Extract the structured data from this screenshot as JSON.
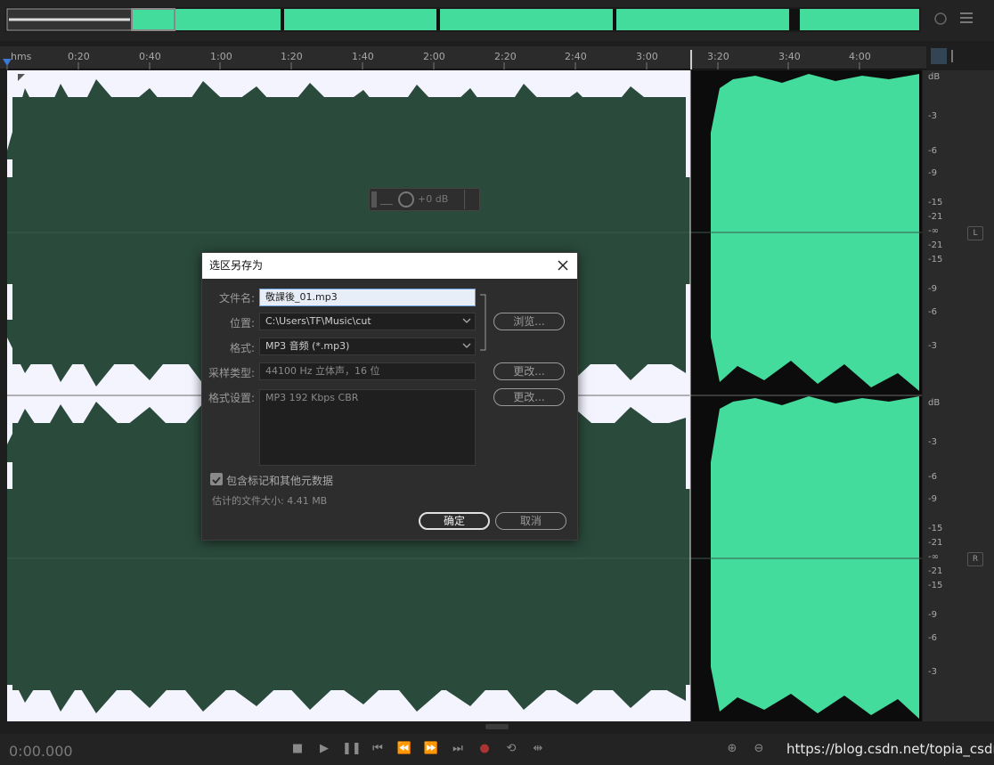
{
  "ruler": {
    "unit_label": "hms",
    "ticks": [
      "0:20",
      "0:40",
      "1:00",
      "1:20",
      "1:40",
      "2:00",
      "2:20",
      "2:40",
      "3:00",
      "3:20",
      "3:40",
      "4:00"
    ]
  },
  "hud": {
    "gain": "+0 dB"
  },
  "db_scale": {
    "top_labels": [
      "dB",
      "-3",
      "-6",
      "-9",
      "-15",
      "-21",
      "-∞",
      "-21",
      "-15",
      "-9",
      "-6",
      "-3"
    ],
    "bottom_labels": [
      "dB",
      "-3",
      "-6",
      "-9",
      "-15",
      "-21",
      "-∞",
      "-21",
      "-15",
      "-9",
      "-6",
      "-3"
    ],
    "left_channel": "L",
    "right_channel": "R"
  },
  "dialog": {
    "title": "选区另存为",
    "filename_label": "文件名:",
    "filename_value": "敬課後_01.mp3",
    "location_label": "位置:",
    "location_value": "C:\\Users\\TF\\Music\\cut",
    "browse_label": "浏览...",
    "format_label": "格式:",
    "format_value": "MP3 音频 (*.mp3)",
    "sample_type_label": "采样类型:",
    "sample_type_value": "44100 Hz 立体声，16 位",
    "change_label_1": "更改...",
    "format_settings_label": "格式设置:",
    "format_settings_value": "MP3 192 Kbps CBR",
    "change_label_2": "更改...",
    "include_markers_label": "包含标记和其他元数据",
    "include_markers_checked": true,
    "estimated_size": "估计的文件大小: 4.41 MB",
    "ok_label": "确定",
    "cancel_label": "取消"
  },
  "transport": {
    "timecode": "0:00.000",
    "watermark": "https://blog.csdn.net/topia_csdn"
  },
  "colors": {
    "selected_bg": "#f4f4ff",
    "selected_wave": "#2a4a3c",
    "wave": "#43dc9c"
  }
}
